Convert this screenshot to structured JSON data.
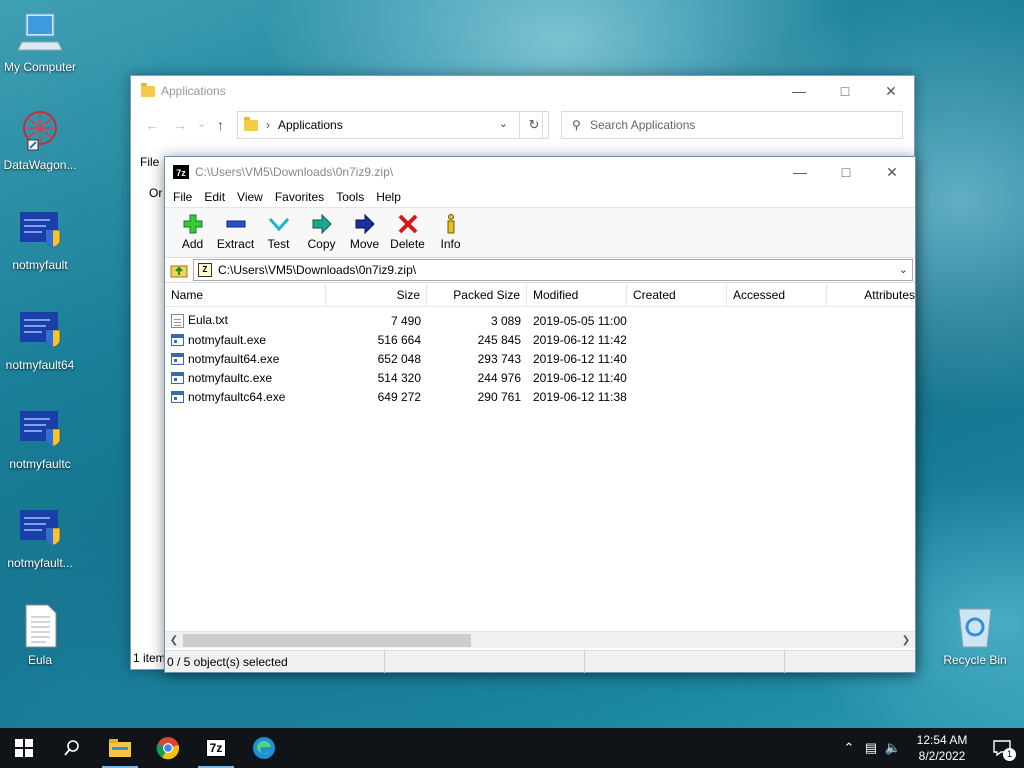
{
  "desktop": {
    "icons": [
      {
        "label": "My Computer"
      },
      {
        "label": "DataWagon..."
      },
      {
        "label": "notmyfault"
      },
      {
        "label": "notmyfault64"
      },
      {
        "label": "notmyfaultc"
      },
      {
        "label": "notmyfault..."
      },
      {
        "label": "Eula"
      },
      {
        "label": "Recycle Bin"
      }
    ]
  },
  "explorer": {
    "title": "Applications",
    "address": "Applications",
    "search_placeholder": "Search Applications",
    "menu_file": "File",
    "org_label": "Or",
    "status": "1 item"
  },
  "sevenzip": {
    "logo": "7z",
    "title": "C:\\Users\\VM5\\Downloads\\0n7iz9.zip\\",
    "menu": [
      "File",
      "Edit",
      "View",
      "Favorites",
      "Tools",
      "Help"
    ],
    "toolbar": [
      "Add",
      "Extract",
      "Test",
      "Copy",
      "Move",
      "Delete",
      "Info"
    ],
    "path": "C:\\Users\\VM5\\Downloads\\0n7iz9.zip\\",
    "columns": [
      "Name",
      "Size",
      "Packed Size",
      "Modified",
      "Created",
      "Accessed",
      "Attributes"
    ],
    "files": [
      {
        "name": "Eula.txt",
        "size": "7 490",
        "packed": "3 089",
        "modified": "2019-05-05 11:00",
        "type": "txt"
      },
      {
        "name": "notmyfault.exe",
        "size": "516 664",
        "packed": "245 845",
        "modified": "2019-06-12 11:42",
        "type": "exe"
      },
      {
        "name": "notmyfault64.exe",
        "size": "652 048",
        "packed": "293 743",
        "modified": "2019-06-12 11:40",
        "type": "exe"
      },
      {
        "name": "notmyfaultc.exe",
        "size": "514 320",
        "packed": "244 976",
        "modified": "2019-06-12 11:40",
        "type": "exe"
      },
      {
        "name": "notmyfaultc64.exe",
        "size": "649 272",
        "packed": "290 761",
        "modified": "2019-06-12 11:38",
        "type": "exe"
      }
    ],
    "status": "0 / 5 object(s) selected"
  },
  "taskbar": {
    "time": "12:54 AM",
    "date": "8/2/2022",
    "notification_count": "1"
  },
  "colors": {
    "taskbar": "#101418",
    "accent": "#76b9ed"
  }
}
